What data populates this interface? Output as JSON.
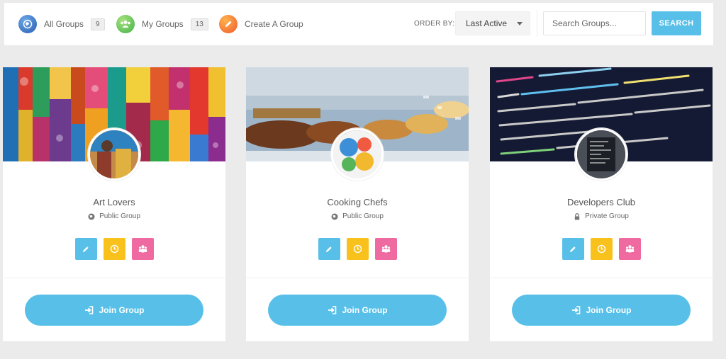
{
  "filters": {
    "all_groups": {
      "label": "All Groups",
      "count": "9"
    },
    "my_groups": {
      "label": "My Groups",
      "count": "13"
    },
    "create_group": {
      "label": "Create A Group"
    },
    "order_by_label": "ORDER BY:",
    "order_by_value": "Last Active",
    "search_placeholder": "Search Groups...",
    "search_button": "SEARCH"
  },
  "icons": {
    "all_groups": "globe-icon",
    "my_groups": "users-icon",
    "create_group": "pencil-icon",
    "public": "globe-icon",
    "private": "lock-icon",
    "edit": "pencil-icon",
    "activity": "clock-icon",
    "members": "group-icon",
    "join": "sign-in-icon"
  },
  "colors": {
    "accent": "#58c0e8",
    "yellow": "#f8c11c",
    "pink": "#ef6aa0"
  },
  "groups": [
    {
      "name": "Art Lovers",
      "type": "Public Group",
      "join_label": "Join Group"
    },
    {
      "name": "Cooking Chefs",
      "type": "Public Group",
      "join_label": "Join Group"
    },
    {
      "name": "Developers Club",
      "type": "Private Group",
      "join_label": "Join Group"
    }
  ]
}
